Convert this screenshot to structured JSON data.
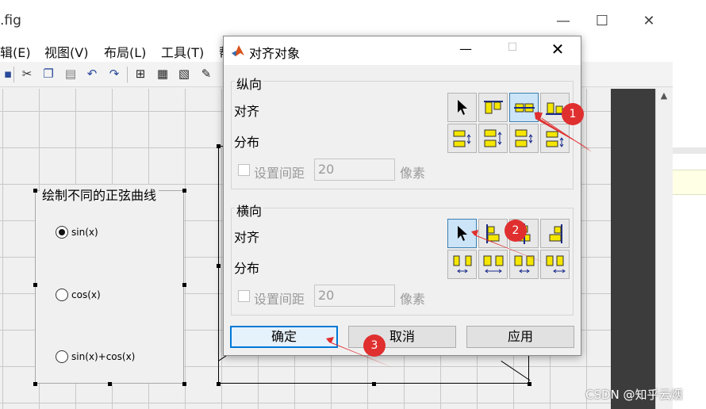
{
  "background_window": {
    "title_fragment": ".fig",
    "menu": [
      "辑(E)",
      "视图(V)",
      "布局(L)",
      "工具(T)",
      "帮"
    ],
    "controls": {
      "minimize": "—",
      "maximize": "☐",
      "close": "✕"
    }
  },
  "panel": {
    "title": "绘制不同的正弦曲线",
    "options": [
      {
        "label": "sin(x)",
        "selected": true
      },
      {
        "label": "cos(x)",
        "selected": false
      },
      {
        "label": "sin(x)+cos(x)",
        "selected": false
      }
    ]
  },
  "dialog": {
    "title": "对齐对象",
    "vertical": {
      "title": "纵向",
      "align_label": "对齐",
      "distribute_label": "分布",
      "spacing_label": "设置间距",
      "spacing_value": "20",
      "unit": "像素"
    },
    "horizontal": {
      "title": "横向",
      "align_label": "对齐",
      "distribute_label": "分布",
      "spacing_label": "设置间距",
      "spacing_value": "20",
      "unit": "像素"
    },
    "buttons": {
      "ok": "确定",
      "cancel": "取消",
      "apply": "应用"
    }
  },
  "annotations": [
    "1",
    "2",
    "3"
  ],
  "watermark": "CSDN @知乎云烟",
  "colors": {
    "annotation_red": "#e02f2f",
    "active_blue": "#cce4f7",
    "icon_yellow": "#f5e600"
  }
}
